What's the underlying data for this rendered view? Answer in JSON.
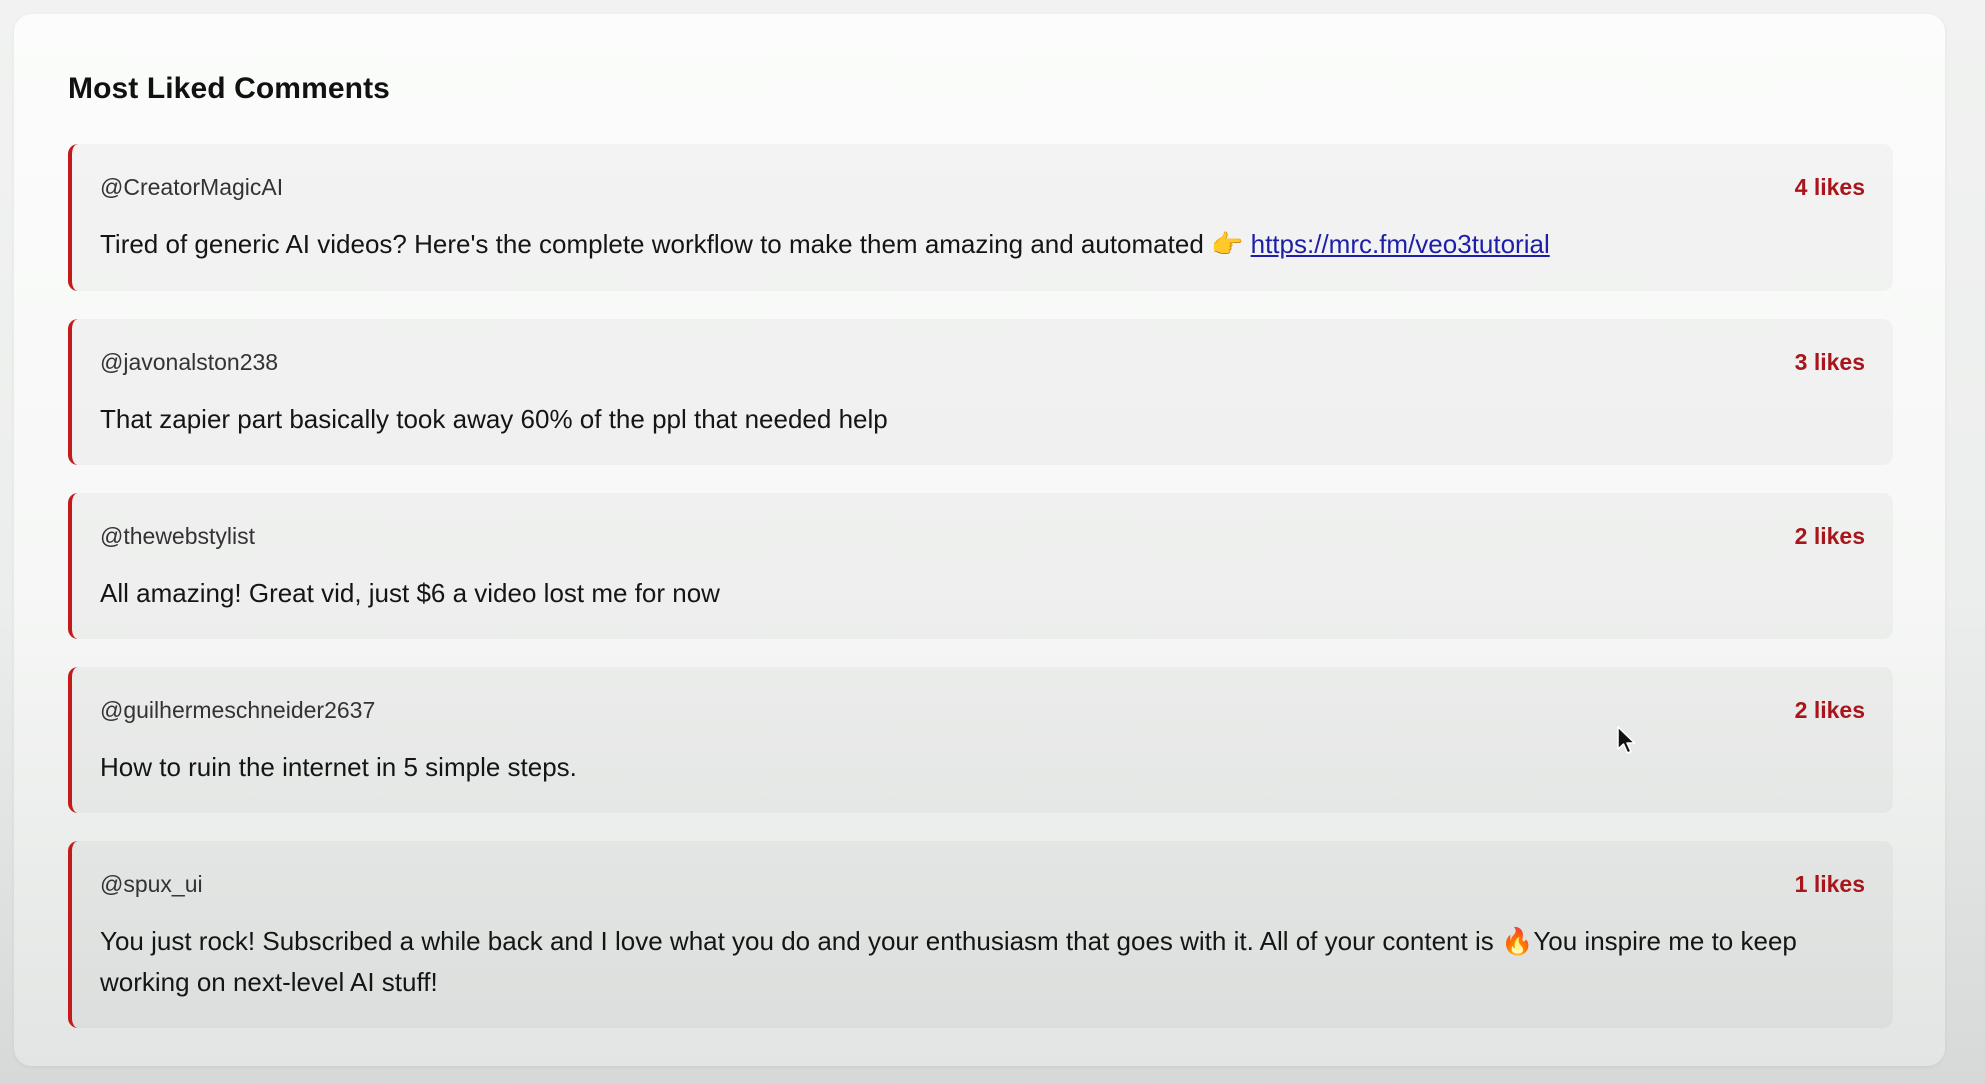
{
  "section": {
    "title": "Most Liked Comments"
  },
  "comments": [
    {
      "author": "@CreatorMagicAI",
      "likes": "4 likes",
      "text": "Tired of generic AI videos? Here's the complete workflow to make them amazing and automated",
      "emoji": "👉",
      "link": "https://mrc.fm/veo3tutorial"
    },
    {
      "author": "@javonalston238",
      "likes": "3 likes",
      "text": "That zapier part basically took away 60% of the ppl that needed help"
    },
    {
      "author": "@thewebstylist",
      "likes": "2 likes",
      "text": "All amazing! Great vid, just $6 a video lost me for now"
    },
    {
      "author": "@guilhermeschneider2637",
      "likes": "2 likes",
      "text": "How to ruin the internet in 5 simple steps."
    },
    {
      "author": "@spux_ui",
      "likes": "1 likes",
      "text_before": "You just rock! Subscribed a while back and I love what you do and your enthusiasm that goes with it. All of your content is",
      "emoji": "🔥",
      "text_after": "You inspire me to keep working on next-level AI stuff!"
    }
  ],
  "colors": {
    "accent_border": "#c41a1a",
    "likes_text": "#a8161b",
    "link": "#1d1fa8"
  },
  "icons": {
    "cursor": "mouse-pointer-icon"
  }
}
